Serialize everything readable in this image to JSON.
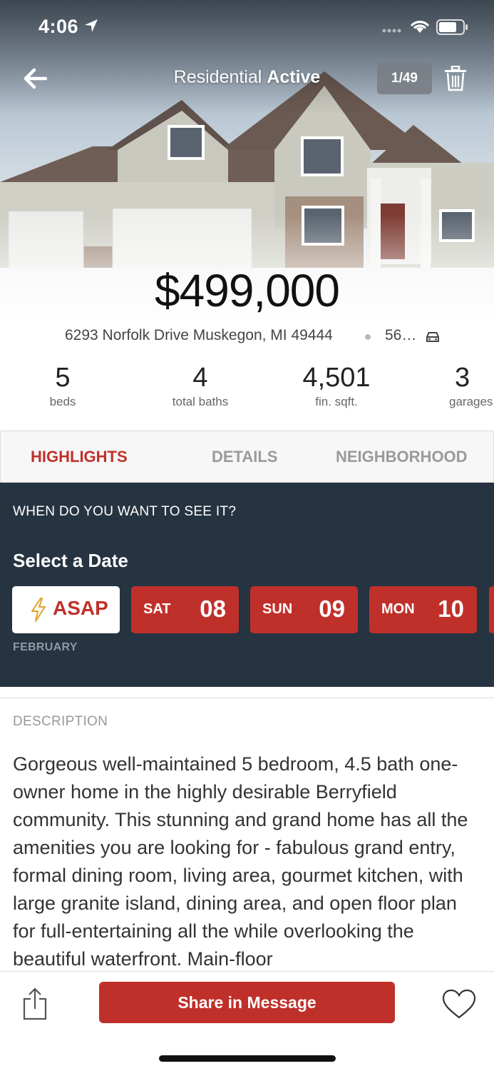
{
  "status_bar": {
    "time": "4:06"
  },
  "nav": {
    "title_prefix": "Residential",
    "title_status": "Active",
    "photo_counter": "1/49"
  },
  "listing": {
    "price": "$499,000",
    "address": "6293 Norfolk Drive Muskegon, MI 49444",
    "commute": "56…"
  },
  "stats": [
    {
      "value": "5",
      "label": "beds"
    },
    {
      "value": "4",
      "label": "total baths"
    },
    {
      "value": "4,501",
      "label": "fin. sqft."
    },
    {
      "value": "3",
      "label": "garages"
    }
  ],
  "tabs": [
    {
      "label": "HIGHLIGHTS",
      "active": true
    },
    {
      "label": "DETAILS",
      "active": false
    },
    {
      "label": "NEIGHBORHOOD",
      "active": false
    }
  ],
  "schedule": {
    "question": "WHEN DO YOU WANT TO SEE IT?",
    "title": "Select a Date",
    "asap_label": "ASAP",
    "dates": [
      {
        "dow": "SAT",
        "day": "08"
      },
      {
        "dow": "SUN",
        "day": "09"
      },
      {
        "dow": "MON",
        "day": "10"
      }
    ],
    "month": "FEBRUARY"
  },
  "description": {
    "label": "DESCRIPTION",
    "text": "Gorgeous well-maintained 5 bedroom, 4.5 bath one-owner home in the highly desirable Berryfield community.  This stunning and grand home has all the amenities you are looking for - fabulous grand entry, formal dining room, living area, gourmet kitchen, with large granite island, dining area, and open floor plan for full-entertaining all the while overlooking the beautiful waterfront.  Main-floor"
  },
  "bottom_bar": {
    "share_label": "Share in Message"
  },
  "colors": {
    "accent": "#c0302a",
    "schedule_bg": "#263340",
    "tab_inactive": "#9a9a9a"
  },
  "icons": [
    "back-arrow-icon",
    "trash-icon",
    "car-icon",
    "lightning-icon",
    "share-icon",
    "heart-icon",
    "wifi-icon",
    "battery-icon",
    "location-arrow-icon"
  ]
}
